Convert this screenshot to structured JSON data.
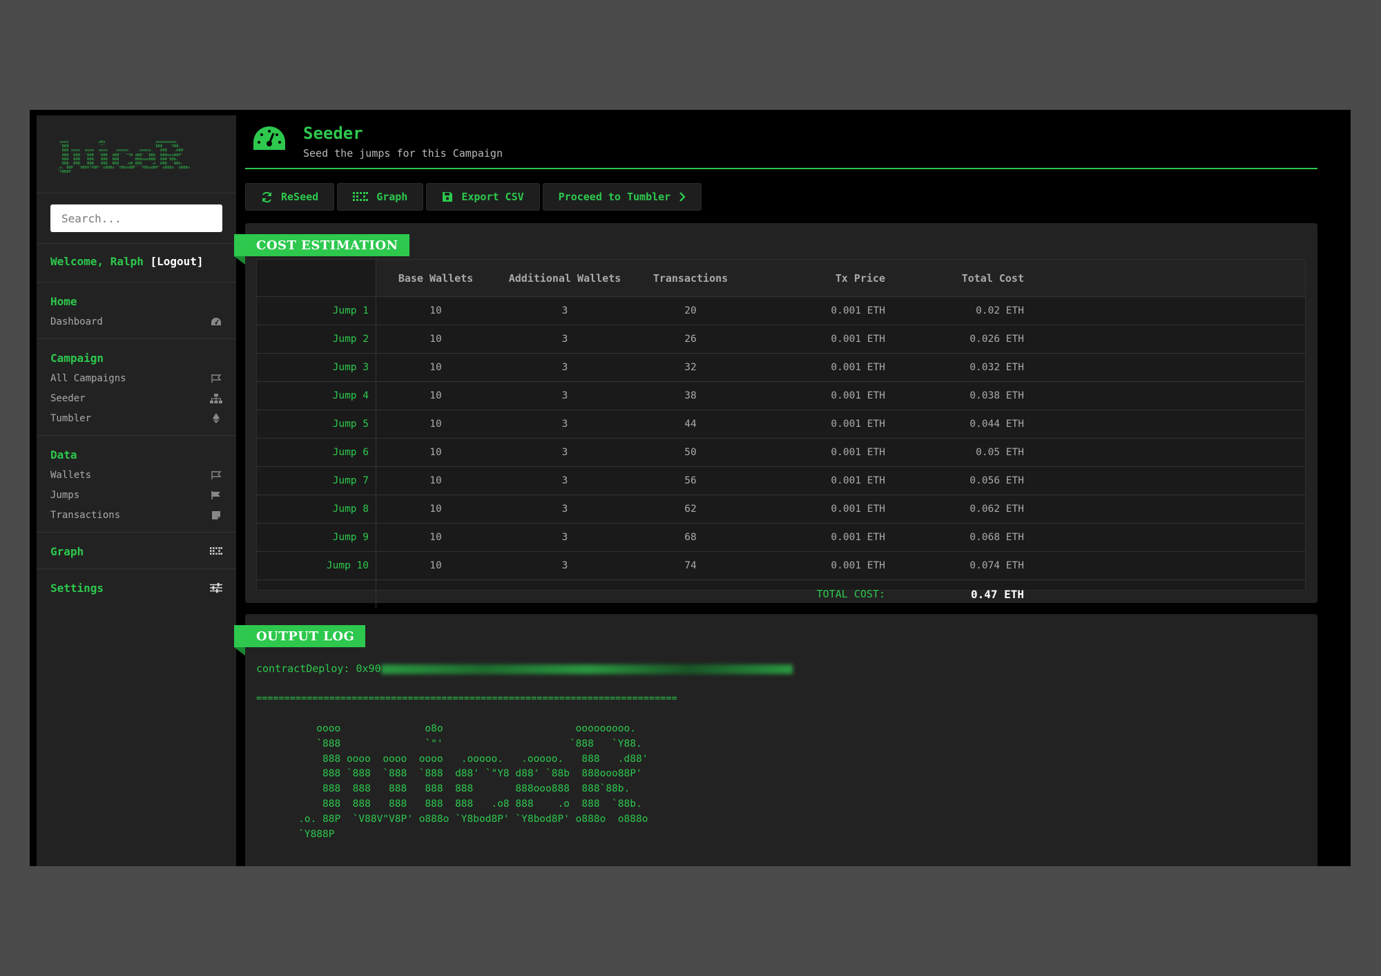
{
  "sidebar": {
    "logo_ascii": " oooo             o8o                      ooooooooo.\n `888             `\"'                     `888   `Y88.\n  888 oooo  oooo  oooo   .ooooo.   .ooooo.   888   .d88'\n  888 `888  `888  `888  d88' `\"Y8 d88' `88b  888ooo88P'\n  888  888   888   888  888       888ooo888  888`88b.\n  888  888   888   888  888   .o8 888    .o  888  `88b.\n.o. 88P  `V88V\"V8P' o888o `Y8bod8P' `Y8bod8P' o888o  o888o\n`Y888P",
    "search_placeholder": "Search...",
    "welcome": "Welcome, Ralph",
    "logout": "[Logout]",
    "sections": [
      {
        "title": "Home",
        "items": [
          {
            "label": "Dashboard",
            "icon": "dashboard-icon"
          }
        ]
      },
      {
        "title": "Campaign",
        "items": [
          {
            "label": "All Campaigns",
            "icon": "flag-outline-icon"
          },
          {
            "label": "Seeder",
            "icon": "sitemap-icon"
          },
          {
            "label": "Tumbler",
            "icon": "ethereum-icon"
          }
        ]
      },
      {
        "title": "Data",
        "items": [
          {
            "label": "Wallets",
            "icon": "flag-outline-icon"
          },
          {
            "label": "Jumps",
            "icon": "flag-solid-icon"
          },
          {
            "label": "Transactions",
            "icon": "sticky-note-icon"
          }
        ]
      },
      {
        "title": "Graph",
        "icon": "graph-icon"
      },
      {
        "title": "Settings",
        "icon": "sliders-icon"
      }
    ]
  },
  "header": {
    "title": "Seeder",
    "subtitle": "Seed the jumps for this Campaign",
    "icon": "speedometer-icon"
  },
  "toolbar": {
    "reseed": "ReSeed",
    "graph": "Graph",
    "export": "Export CSV",
    "proceed": "Proceed to Tumbler"
  },
  "cost_panel": {
    "title": "COST ESTIMATION",
    "columns": [
      "Base Wallets",
      "Additional Wallets",
      "Transactions",
      "Tx Price",
      "Total Cost"
    ],
    "rows": [
      {
        "jump": "Jump 1",
        "base": "10",
        "additional": "3",
        "tx": "20",
        "price": "0.001 ETH",
        "total": "0.02 ETH"
      },
      {
        "jump": "Jump 2",
        "base": "10",
        "additional": "3",
        "tx": "26",
        "price": "0.001 ETH",
        "total": "0.026 ETH"
      },
      {
        "jump": "Jump 3",
        "base": "10",
        "additional": "3",
        "tx": "32",
        "price": "0.001 ETH",
        "total": "0.032 ETH"
      },
      {
        "jump": "Jump 4",
        "base": "10",
        "additional": "3",
        "tx": "38",
        "price": "0.001 ETH",
        "total": "0.038 ETH"
      },
      {
        "jump": "Jump 5",
        "base": "10",
        "additional": "3",
        "tx": "44",
        "price": "0.001 ETH",
        "total": "0.044 ETH"
      },
      {
        "jump": "Jump 6",
        "base": "10",
        "additional": "3",
        "tx": "50",
        "price": "0.001 ETH",
        "total": "0.05 ETH"
      },
      {
        "jump": "Jump 7",
        "base": "10",
        "additional": "3",
        "tx": "56",
        "price": "0.001 ETH",
        "total": "0.056 ETH"
      },
      {
        "jump": "Jump 8",
        "base": "10",
        "additional": "3",
        "tx": "62",
        "price": "0.001 ETH",
        "total": "0.062 ETH"
      },
      {
        "jump": "Jump 9",
        "base": "10",
        "additional": "3",
        "tx": "68",
        "price": "0.001 ETH",
        "total": "0.068 ETH"
      },
      {
        "jump": "Jump 10",
        "base": "10",
        "additional": "3",
        "tx": "74",
        "price": "0.001 ETH",
        "total": "0.074 ETH"
      }
    ],
    "total_label": "TOTAL COST:",
    "total_value": "0.47 ETH"
  },
  "log_panel": {
    "title": "OUTPUT LOG",
    "contract_prefix": "contractDeploy: 0x90",
    "separator": "===========================================================================",
    "ascii": "          oooo              o8o                      ooooooooo.\n          `888              `\"'                     `888   `Y88.\n           888 oooo  oooo  oooo   .ooooo.   .ooooo.   888   .d88'\n           888 `888  `888  `888  d88' `\"Y8 d88' `88b  888ooo88P'\n           888  888   888   888  888       888ooo888  888`88b.\n           888  888   888   888  888   .o8 888    .o  888  `88b.\n       .o. 88P  `V88V\"V8P' o888o `Y8bod8P' `Y8bod8P' o888o  o888o\n       `Y888P"
  },
  "colors": {
    "accent": "#2dc84d",
    "background": "#000000",
    "panel": "#222222"
  }
}
